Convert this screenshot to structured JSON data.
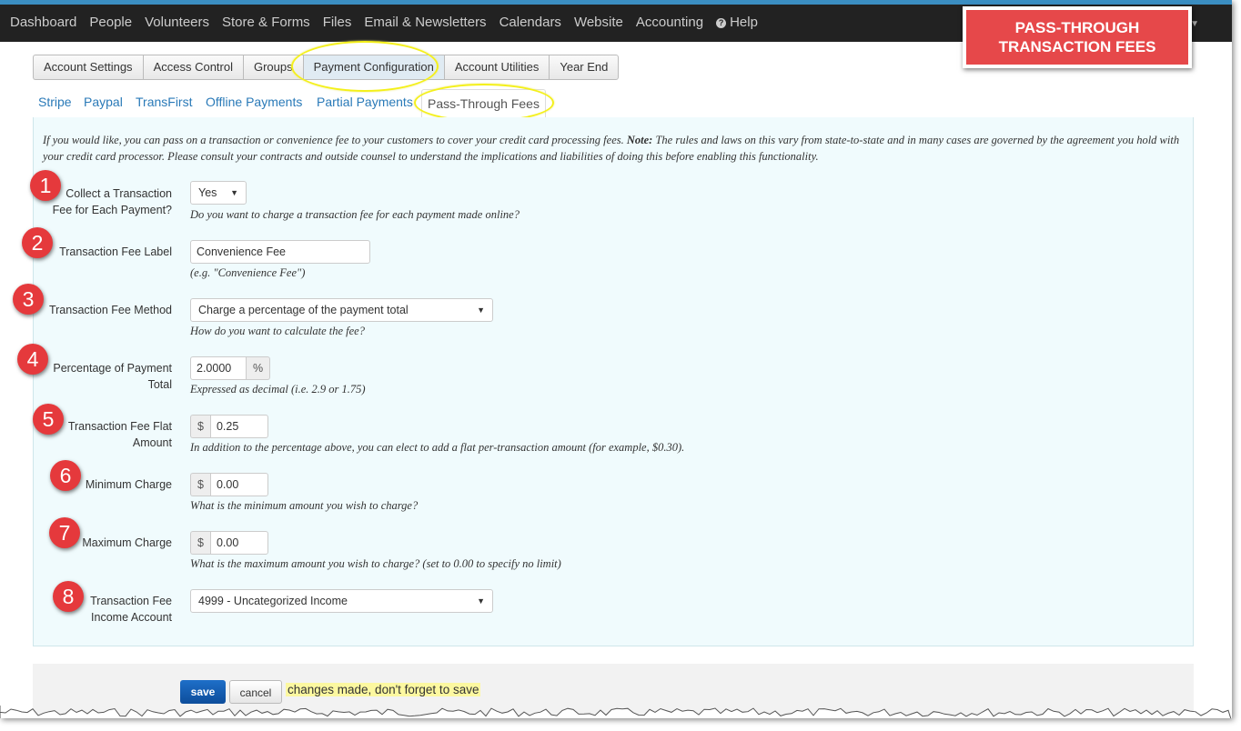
{
  "nav": {
    "items": [
      "Dashboard",
      "People",
      "Volunteers",
      "Store & Forms",
      "Files",
      "Email & Newsletters",
      "Calendars",
      "Website",
      "Accounting"
    ],
    "help_label": "Help",
    "help_icon": "question-circle-icon"
  },
  "banner": {
    "line1": "PASS-THROUGH",
    "line2": "TRANSACTION FEES",
    "color": "#e6484a"
  },
  "subtabs": [
    "Account Settings",
    "Access Control",
    "Groups",
    "Payment Configuration",
    "Account Utilities",
    "Year End"
  ],
  "active_subtab": "Payment Configuration",
  "payment_tabs": [
    "Stripe",
    "Paypal",
    "TransFirst",
    "Offline Payments",
    "Partial Payments",
    "Pass-Through Fees"
  ],
  "active_payment_tab": "Pass-Through Fees",
  "intro": {
    "text_before": "If you would like, you can pass on a transaction or convenience fee to your customers to cover your credit card processing fees. ",
    "note_label": "Note:",
    "text_after": " The rules and laws on this vary from state-to-state and in many cases are governed by the agreement you hold with your credit card processor. Please consult your contracts and outside counsel to understand the implications and liabilities of doing this before enabling this functionality."
  },
  "fields": {
    "collect": {
      "badge": "1",
      "label_line1": "Collect a Transaction",
      "label_line2": "Fee for Each Payment?",
      "value": "Yes",
      "help": "Do you want to charge a transaction fee for each payment made online?"
    },
    "label": {
      "badge": "2",
      "label": "Transaction Fee Label",
      "value": "Convenience Fee",
      "help": "(e.g. \"Convenience Fee\")"
    },
    "method": {
      "badge": "3",
      "label": "Transaction Fee Method",
      "value": "Charge a percentage of the payment total",
      "help": "How do you want to calculate the fee?"
    },
    "percentage": {
      "badge": "4",
      "label_line1": "Percentage of Payment",
      "label_line2": "Total",
      "value": "2.0000",
      "addon": "%",
      "help": "Expressed as decimal (i.e. 2.9 or 1.75)"
    },
    "flat": {
      "badge": "5",
      "label_line1": "Transaction Fee Flat",
      "label_line2": "Amount",
      "addon": "$",
      "value": "0.25",
      "help": "In addition to the percentage above, you can elect to add a flat per-transaction amount (for example, $0.30)."
    },
    "minimum": {
      "badge": "6",
      "label": "Minimum Charge",
      "addon": "$",
      "value": "0.00",
      "help": "What is the minimum amount you wish to charge?"
    },
    "maximum": {
      "badge": "7",
      "label": "Maximum Charge",
      "addon": "$",
      "value": "0.00",
      "help": "What is the maximum amount you wish to charge? (set to 0.00 to specify no limit)"
    },
    "account": {
      "badge": "8",
      "label_line1": "Transaction Fee",
      "label_line2": "Income Account",
      "value": "4999 - Uncategorized Income"
    }
  },
  "footer": {
    "save_label": "save",
    "cancel_label": "cancel",
    "changes_text": "changes made, don't forget to save"
  },
  "colors": {
    "accent": "#3b8ec2",
    "badge": "#e5393c",
    "highlight": "#f4f01a",
    "panel_bg": "#f0fbfd"
  }
}
